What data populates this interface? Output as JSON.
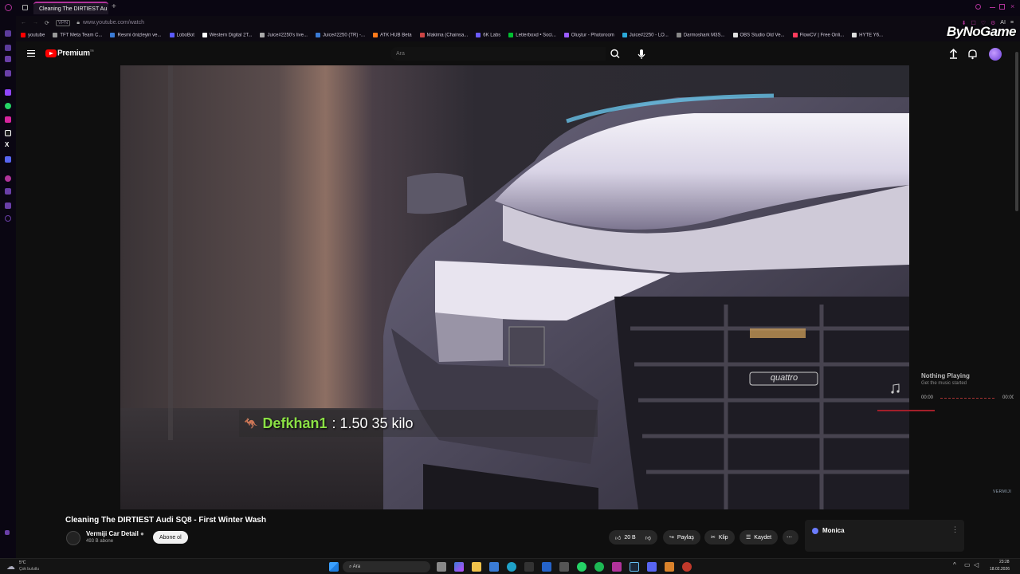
{
  "browser": {
    "tab_title": "Cleaning The DIRTIEST Au",
    "url": "www.youtube.com/watch",
    "vpn_label": "VPN",
    "bookmarks": [
      {
        "label": "youtube",
        "color": "#ff0000"
      },
      {
        "label": "TFT Meta Team C...",
        "color": "#999999"
      },
      {
        "label": "Resmi önizleyin ve...",
        "color": "#3a7bd5"
      },
      {
        "label": "LoboBot",
        "color": "#5a5aff"
      },
      {
        "label": "Western Digital 2T...",
        "color": "#ffffff"
      },
      {
        "label": "Juice#2250's live...",
        "color": "#aaaaaa"
      },
      {
        "label": "Juice#2250 (TR) -...",
        "color": "#3a7bd5"
      },
      {
        "label": "ATK HUB Beta",
        "color": "#ff7a1a"
      },
      {
        "label": "Makima (Chainsa...",
        "color": "#c44"
      },
      {
        "label": "6K Labs",
        "color": "#6b5bff"
      },
      {
        "label": "Letterboxd • Soci...",
        "color": "#00c030"
      },
      {
        "label": "Oluştur - Photoroom",
        "color": "#9b5cff"
      },
      {
        "label": "Juice#2250 - LO...",
        "color": "#2aa8d8"
      },
      {
        "label": "Darmoshark M3S...",
        "color": "#888888"
      },
      {
        "label": "OBS Studio Old Ve...",
        "color": "#e0e0e0"
      },
      {
        "label": "FlowCV | Free Onli...",
        "color": "#ff3b5c"
      },
      {
        "label": "HYTE Y6...",
        "color": "#dddddd"
      }
    ],
    "ai_label": "AI"
  },
  "watermark": "ByNoGame",
  "header": {
    "logo_text": "Premium",
    "logo_sup": "TR",
    "search_placeholder": "Ara"
  },
  "overlay": {
    "chat_user": "Defkhan1",
    "chat_message": ": 1.50 35 kilo"
  },
  "now_playing": {
    "title": "Nothing Playing",
    "subtitle": "Get the music started",
    "time_start": "00:00",
    "time_end": "00:00"
  },
  "video": {
    "title": "Cleaning The DIRTIEST Audi SQ8 - First Winter Wash",
    "channel": "Vermiji Car Detail",
    "subscribers": "493 B abone",
    "subscribe_label": "Abone ol",
    "likes": "20 B",
    "share_label": "Paylaş",
    "clip_label": "Klip",
    "save_label": "Kaydet",
    "grille_badge": "quattro",
    "corner_logo": "VERMIJI"
  },
  "monica": {
    "label": "Monica"
  },
  "taskbar": {
    "weather_temp": "5°C",
    "weather_desc": "Çok bulutlu",
    "search_label": "Ara",
    "time": "23:28",
    "date": "18.02.2026"
  }
}
